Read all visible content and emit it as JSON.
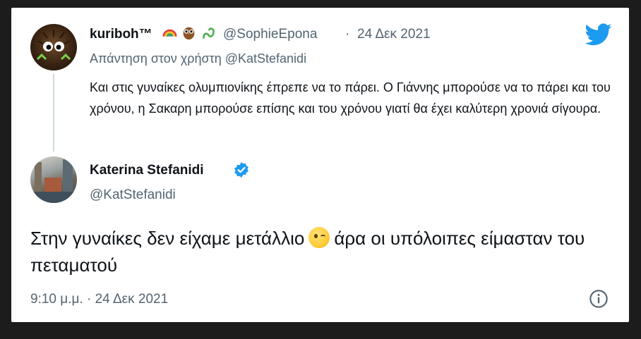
{
  "reply_tweet": {
    "display_name": "kuriboh™",
    "emojis": [
      "rainbow-icon",
      "owl-icon",
      "snake-icon"
    ],
    "handle": "@SophieEpona",
    "separator": "·",
    "date": "24 Δεκ 2021",
    "replying_to": "Απάντηση στον χρήστη @KatStefanidi",
    "text": "Και στις γυναίκες ολυμπιονίκης έπρεπε να το πάρει. Ο Γιάννης μπορούσε να το πάρει και του χρόνου, η Σακαρη μπορούσε επίσης και του χρόνου γιατί θα έχει καλύτερη χρονιά σίγουρα."
  },
  "main_tweet": {
    "display_name": "Katerina Stefanidi",
    "verified": true,
    "handle": "@KatStefanidi",
    "text_before_emoji": "Στην γυναίκες δεν είχαμε μετάλλιο",
    "emoji": "winking-face-icon",
    "text_after_emoji": "άρα οι υπόλοιπες είμασταν του πεταματού",
    "timestamp": "9:10 μ.μ. · 24 Δεκ 2021"
  },
  "colors": {
    "twitter_blue": "#1d9bf0",
    "muted": "#536471",
    "text": "#0f1419",
    "background": "#1c1c1c"
  }
}
